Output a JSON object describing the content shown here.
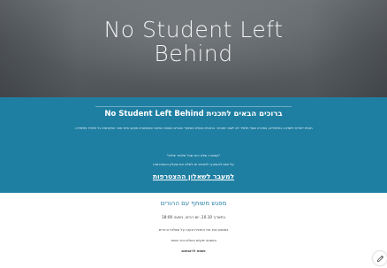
{
  "hero": {
    "title_line1": "No Student Left",
    "title_line2": "Behind"
  },
  "welcome": {
    "heading": "ברוכים הבאים לתכנית No Student Left Behind",
    "paragraph": "תכנית ייחודית לתמיכה בתלמידים, במטרה שאף תלמיד לא יישאר מאחור. התכנית פועלת בשיתוף ההורים והצוות החינוכי ומאפשרת מעקב אישי אחר התקדמות כל תלמיד ותלמידה.",
    "quote": "\"המטרה שלנו היא שכל תלמיד יצליח\"",
    "sub": "על מנת להצטרף לתכנית יש למלא את שאלון ההצטרפות",
    "link_label": "למעבר לשאלון ההצטרפות"
  },
  "meeting": {
    "title": "מפגש משותף עם ההורים",
    "date": "בתאריך 10.10, יום רביעי, בשעה 18:00",
    "line1": "במפגש נציג את התכנית ונענה על שאלות ההורים",
    "line2": "המפגש יתקיים באולם בית הספר",
    "line3": "נשמח לראותכם"
  },
  "colors": {
    "band": "#1f7fa3",
    "accent": "#2a7fa6"
  },
  "icons": {
    "edit": "pencil-icon"
  }
}
